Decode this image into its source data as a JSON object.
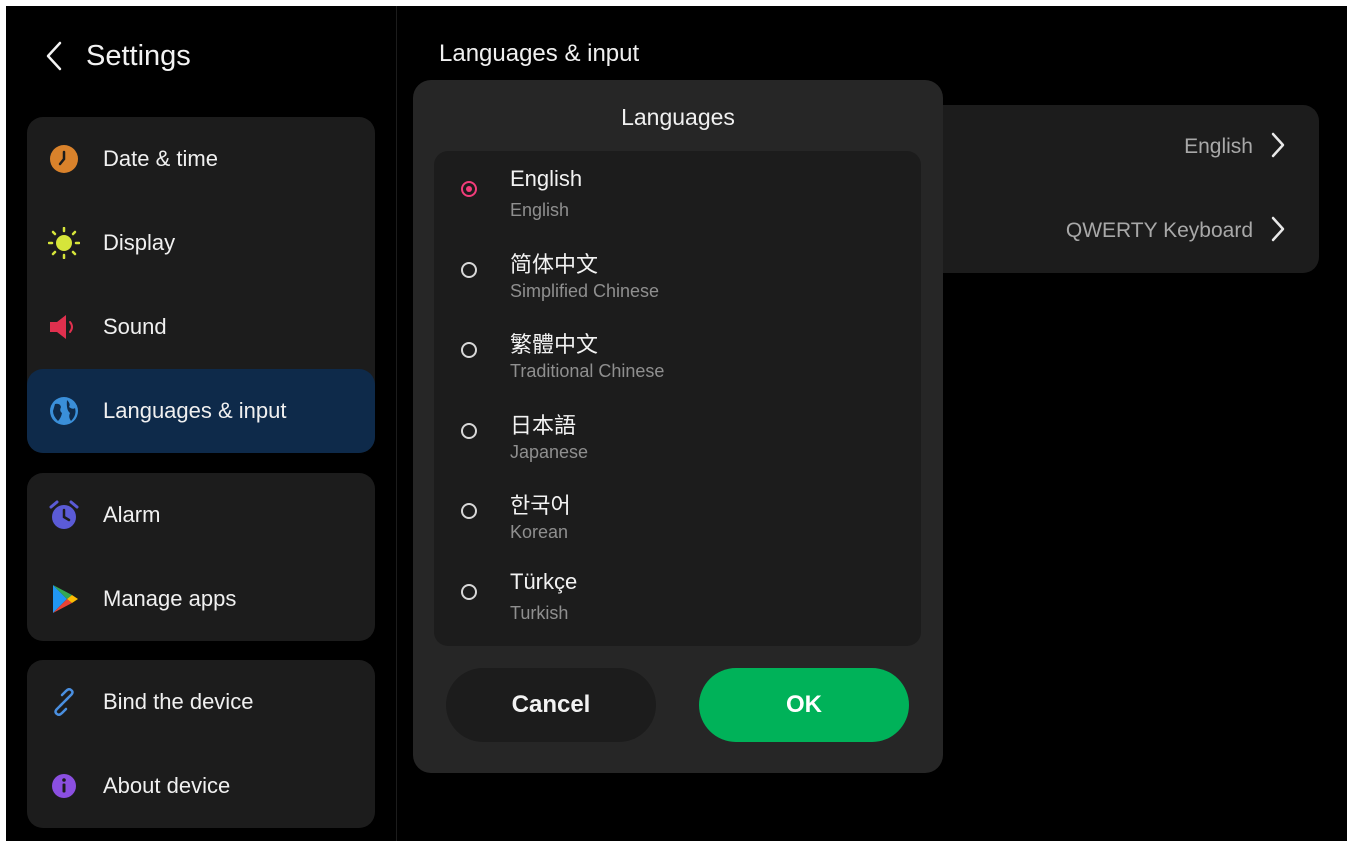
{
  "header": {
    "title": "Settings",
    "back_icon": "chevron-left-icon"
  },
  "sidebar": {
    "groups": [
      [
        {
          "label": "Date & time",
          "icon": "clock-icon",
          "color": "#d9822b"
        },
        {
          "label": "Display",
          "icon": "sun-icon",
          "color": "#d6e53a"
        },
        {
          "label": "Sound",
          "icon": "speaker-icon",
          "color": "#e0304e"
        },
        {
          "label": "Languages & input",
          "icon": "globe-icon",
          "color": "#3a8fd9",
          "active": true
        }
      ],
      [
        {
          "label": "Alarm",
          "icon": "alarm-clock-icon",
          "color": "#5b5bd6"
        },
        {
          "label": "Manage apps",
          "icon": "play-store-icon",
          "color": "#34a853"
        }
      ],
      [
        {
          "label": "Bind the device",
          "icon": "link-icon",
          "color": "#4a8fe0"
        },
        {
          "label": "About device",
          "icon": "info-icon",
          "color": "#8b4fe0"
        }
      ]
    ]
  },
  "main": {
    "title": "Languages & input",
    "rows": [
      {
        "value": "English"
      },
      {
        "value": "QWERTY Keyboard"
      }
    ]
  },
  "dialog": {
    "title": "Languages",
    "options": [
      {
        "name": "English",
        "sub": "English",
        "selected": true
      },
      {
        "name": "简体中文",
        "sub": "Simplified Chinese",
        "selected": false
      },
      {
        "name": "繁體中文",
        "sub": "Traditional Chinese",
        "selected": false
      },
      {
        "name": "日本語",
        "sub": "Japanese",
        "selected": false
      },
      {
        "name": "한국어",
        "sub": "Korean",
        "selected": false
      },
      {
        "name": "Türkçe",
        "sub": "Turkish",
        "selected": false
      }
    ],
    "cancel_label": "Cancel",
    "ok_label": "OK"
  },
  "colors": {
    "accent_radio": "#f23c7a",
    "ok_button": "#00b259",
    "active_item": "#0e2a4a"
  }
}
